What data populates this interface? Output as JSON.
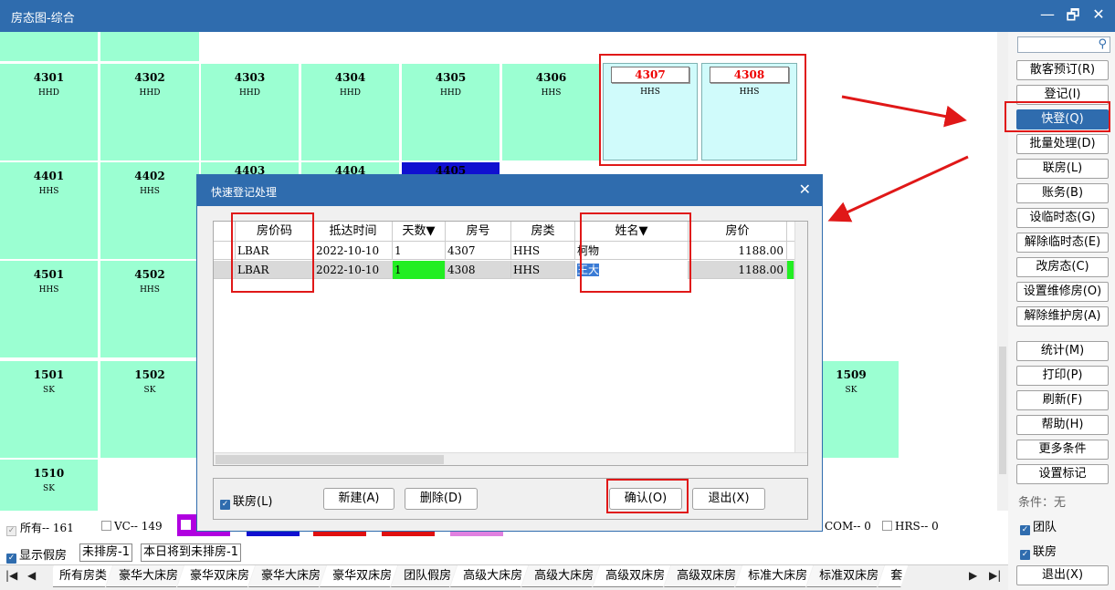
{
  "window": {
    "title": "房态图-综合",
    "minimize": "—",
    "restore": "🗗",
    "close": "✕"
  },
  "rooms": [
    {
      "num": "4301",
      "type": "HHD"
    },
    {
      "num": "4302",
      "type": "HHD"
    },
    {
      "num": "4303",
      "type": "HHD"
    },
    {
      "num": "4304",
      "type": "HHD"
    },
    {
      "num": "4305",
      "type": "HHD"
    },
    {
      "num": "4306",
      "type": "HHS"
    },
    {
      "num": "4307",
      "type": "HHS"
    },
    {
      "num": "4308",
      "type": "HHS"
    },
    {
      "num": "4401",
      "type": "HHS"
    },
    {
      "num": "4402",
      "type": "HHS"
    },
    {
      "num": "4403",
      "type": ""
    },
    {
      "num": "4404",
      "type": ""
    },
    {
      "num": "4405",
      "type": ""
    },
    {
      "num": "4501",
      "type": "HHS"
    },
    {
      "num": "4502",
      "type": "HHS"
    },
    {
      "num": "1501",
      "type": "SK"
    },
    {
      "num": "1502",
      "type": "SK"
    },
    {
      "num": "1509",
      "type": "SK"
    },
    {
      "num": "1510",
      "type": "SK"
    }
  ],
  "right_panel": {
    "search_placeholder": "",
    "buttons": [
      "散客预订(R)",
      "登记(I)",
      "快登(Q)",
      "批量处理(D)",
      "联房(L)",
      "账务(B)",
      "设临时态(G)",
      "解除临时态(E)",
      "改房态(C)",
      "设置维修房(O)",
      "解除维护房(A)",
      "统计(M)",
      "打印(P)",
      "刷新(F)",
      "帮助(H)",
      "更多条件",
      "设置标记"
    ],
    "condition": "条件：无",
    "check_group": "团队",
    "check_link": "联房",
    "exit": "退出(X)"
  },
  "legend": {
    "all": "所有-- 161",
    "vc": "VC-- 149",
    "com": "COM-- 0",
    "hrs": "HRS-- 0",
    "colors": {
      "purple": "#b000e0",
      "blue": "#1010d0",
      "red": "#e01010",
      "pink": "#e080e0"
    }
  },
  "row2": {
    "show_fake": "显示假房",
    "unassigned": "未排房-1",
    "today_unassigned": "本日将到未排房-1"
  },
  "tabs": [
    "所有房类",
    "豪华大床房",
    "豪华双床房",
    "豪华大床房",
    "豪华双床房",
    "团队假房",
    "高级大床房",
    "高级大床房",
    "高级双床房",
    "高级双床房",
    "标准大床房",
    "标准双床房",
    "套"
  ],
  "dialog": {
    "title": "快速登记处理",
    "close": "✕",
    "columns": [
      "房价码",
      "抵达时间",
      "天数▼",
      "房号",
      "房类",
      "姓名▼",
      "房价"
    ],
    "rows": [
      [
        "LBAR",
        "2022-10-10",
        "1",
        "4307",
        "HHS",
        "柯物",
        "1188.00"
      ],
      [
        "LBAR",
        "2022-10-10",
        "1",
        "4308",
        "HHS",
        "王大",
        "1188.00"
      ]
    ],
    "link_checkbox": "联房(L)",
    "new_button": "新建(A)",
    "delete_button": "删除(D)",
    "confirm_button": "确认(O)",
    "exit_button": "退出(X)"
  }
}
